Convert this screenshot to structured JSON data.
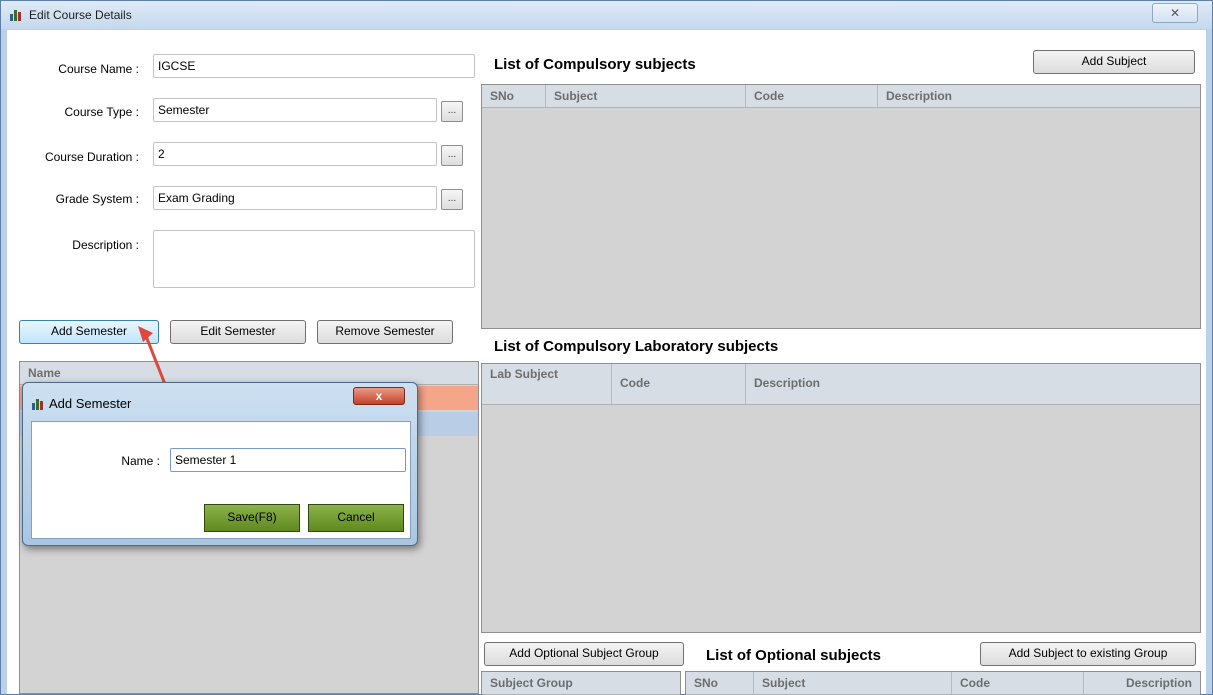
{
  "window": {
    "title": "Edit Course Details",
    "close_glyph": "✕"
  },
  "form": {
    "course_name": {
      "label": "Course Name :",
      "value": "IGCSE"
    },
    "course_type": {
      "label": "Course Type :",
      "value": "Semester"
    },
    "course_duration": {
      "label": "Course Duration :",
      "value": "2"
    },
    "grade_system": {
      "label": "Grade System :",
      "value": "Exam Grading"
    },
    "description": {
      "label": "Description :",
      "value": ""
    },
    "browse_label": "..."
  },
  "semester_buttons": {
    "add": "Add Semester",
    "edit": "Edit Semester",
    "remove": "Remove Semester"
  },
  "semester_list": {
    "header": "Name"
  },
  "compulsory": {
    "title": "List of Compulsory subjects",
    "add_button": "Add Subject",
    "columns": [
      "SNo",
      "Subject",
      "Code",
      "Description"
    ]
  },
  "lab": {
    "title": "List of Compulsory Laboratory subjects",
    "columns": [
      "Lab Subject",
      "Code",
      "Description"
    ]
  },
  "optional": {
    "title": "List of Optional subjects",
    "add_group_button": "Add Optional Subject Group",
    "add_to_group_button": "Add Subject to existing Group",
    "group_column": "Subject Group",
    "columns": [
      "SNo",
      "Subject",
      "Code",
      "Description"
    ]
  },
  "dialog": {
    "title": "Add Semester",
    "close_glyph": "x",
    "name_label": "Name :",
    "name_value": "Semester 1",
    "save": "Save(F8)",
    "cancel": "Cancel"
  },
  "colors": {
    "annotation_arrow": "#e0473d",
    "row_highlight_orange": "#f4a58a",
    "row_highlight_blue": "#b9cde6"
  }
}
